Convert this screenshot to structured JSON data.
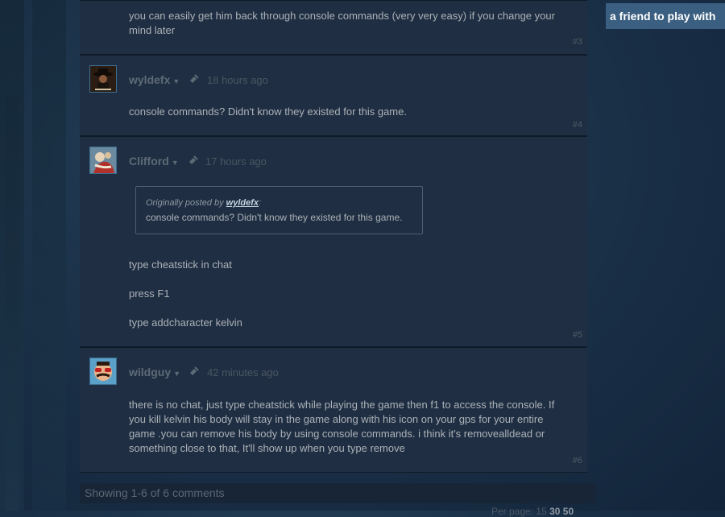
{
  "friend_button": "a friend to play with",
  "comments": [
    {
      "number": "#3",
      "body_lines": [
        "you can easily get him back through console commands (very very easy) if you change your",
        "mind later"
      ]
    },
    {
      "author": "wyldefx",
      "time": "18 hours ago",
      "number": "#4",
      "body_lines": [
        "console commands? Didn't know they existed for this game."
      ]
    },
    {
      "author": "Clifford",
      "time": "17 hours ago",
      "number": "#5",
      "quote": {
        "prefix": "Originally posted by",
        "author": "wyldefx",
        "suffix": ":",
        "text": "console commands? Didn't know they existed for this game."
      },
      "body_lines": [
        "type cheatstick in chat",
        "press F1",
        "type addcharacter kelvin"
      ]
    },
    {
      "author": "wildguy",
      "time": "42 minutes ago",
      "number": "#6",
      "body_lines": [
        "there is no chat, just type cheatstick while playing the game then f1 to access the console. If",
        "you kill kelvin his body will stay in the game along with his icon on your gps for your entire",
        "game .you can remove his body by using console commands. i think it's removealldead or",
        "something close to that, It'll show up when you type remove"
      ]
    }
  ],
  "footer": "Showing 1-6 of 6 comments",
  "pager": {
    "label": "Per page:",
    "options": [
      "15",
      "30",
      "50"
    ]
  },
  "colors": {
    "panel": "#1f2e42",
    "accent": "#3b5f80",
    "quote_author": "#c6d4df"
  }
}
